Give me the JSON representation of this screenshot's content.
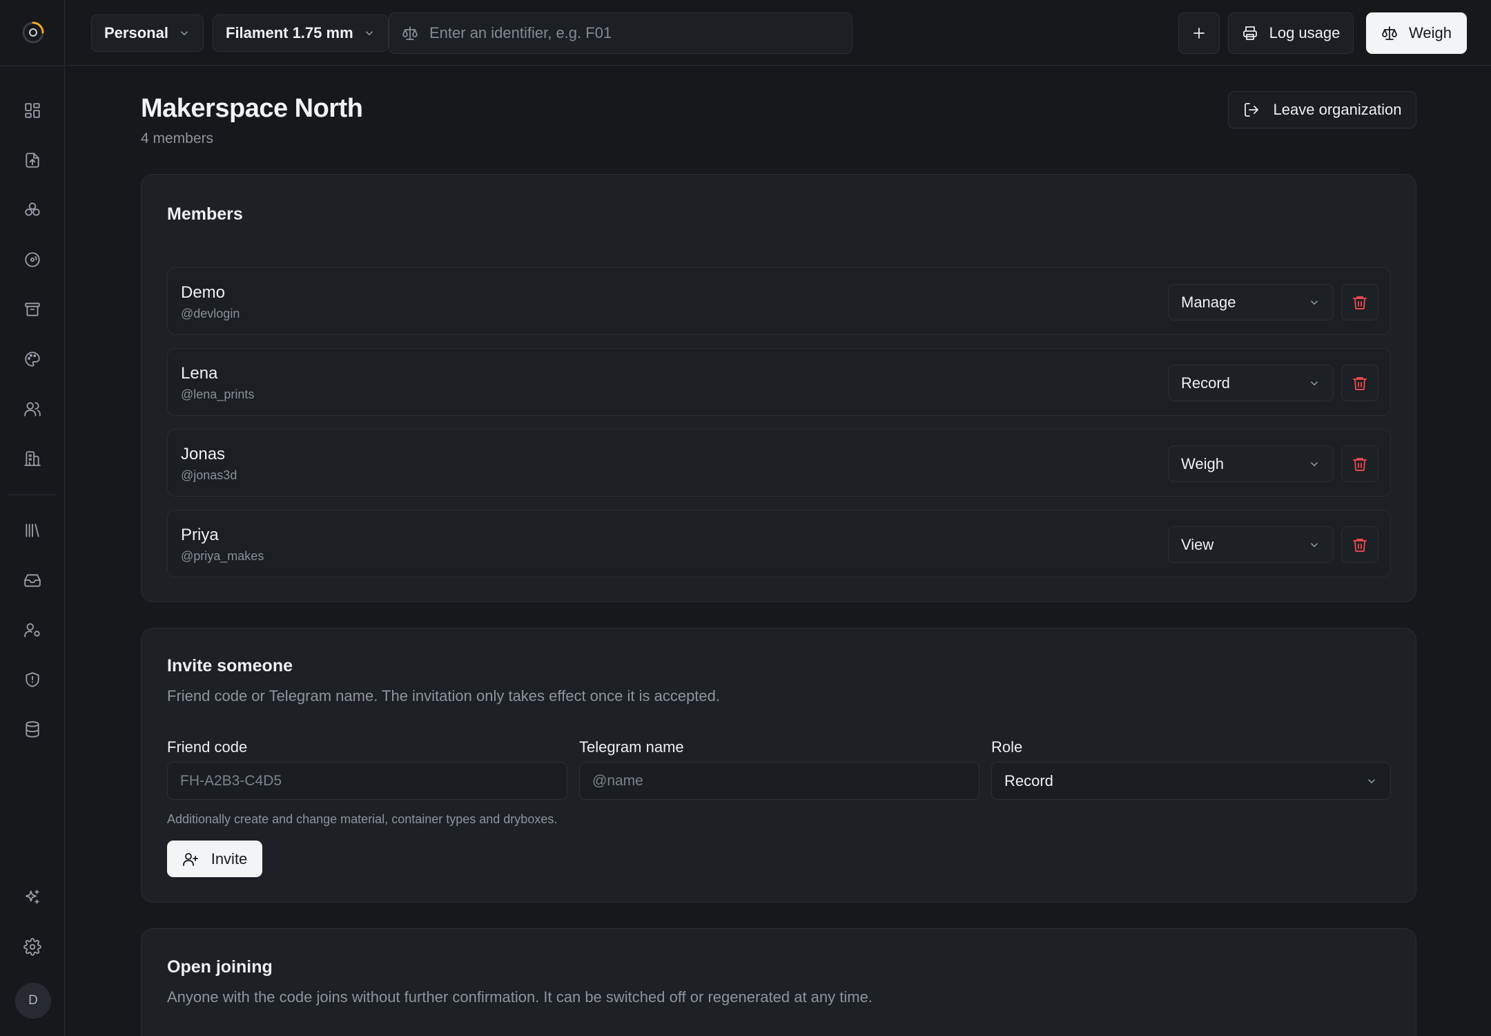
{
  "topbar": {
    "workspace_select": "Personal",
    "filament_select": "Filament 1.75 mm",
    "search_placeholder": "Enter an identifier, e.g. F01",
    "add_label": "+",
    "log_usage_label": "Log usage",
    "weigh_label": "Weigh"
  },
  "sidebar": {
    "avatar_initial": "D",
    "icons": [
      "dashboard-icon",
      "file-upload-icon",
      "spools-icon",
      "reel-icon",
      "archive-icon",
      "palette-icon",
      "users-icon",
      "building-icon",
      "library-icon",
      "inbox-icon",
      "user-settings-icon",
      "shield-icon",
      "database-icon",
      "sparkles-icon",
      "gear-icon"
    ]
  },
  "page": {
    "title": "Makerspace North",
    "subtitle": "4 members",
    "leave_label": "Leave organization"
  },
  "members": {
    "title": "Members",
    "items": [
      {
        "name": "Demo",
        "handle": "@devlogin",
        "role": "Manage"
      },
      {
        "name": "Lena",
        "handle": "@lena_prints",
        "role": "Record"
      },
      {
        "name": "Jonas",
        "handle": "@jonas3d",
        "role": "Weigh"
      },
      {
        "name": "Priya",
        "handle": "@priya_makes",
        "role": "View"
      }
    ]
  },
  "invite": {
    "title": "Invite someone",
    "description": "Friend code or Telegram name. The invitation only takes effect once it is accepted.",
    "friend_code_label": "Friend code",
    "friend_code_placeholder": "FH-A2B3-C4D5",
    "telegram_label": "Telegram name",
    "telegram_placeholder": "@name",
    "role_label": "Role",
    "role_value": "Record",
    "hint": "Additionally create and change material, container types and dryboxes.",
    "button_label": "Invite"
  },
  "open_joining": {
    "title": "Open joining",
    "description": "Anyone with the code joins without further confirmation. It can be switched off or regenerated at any time."
  },
  "colors": {
    "background": "#16181c",
    "card": "#1d2025",
    "danger": "#e5484d",
    "primary_button": "#f3f4f6",
    "logo_accent": "#f5a524"
  }
}
